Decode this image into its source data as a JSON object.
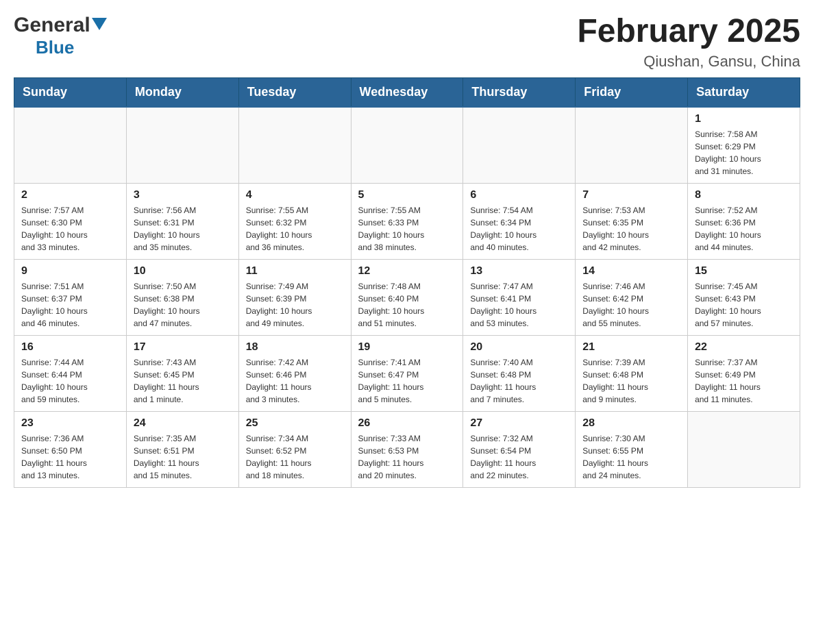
{
  "header": {
    "logo_general": "General",
    "logo_blue": "Blue",
    "title": "February 2025",
    "subtitle": "Qiushan, Gansu, China"
  },
  "days_of_week": [
    "Sunday",
    "Monday",
    "Tuesday",
    "Wednesday",
    "Thursday",
    "Friday",
    "Saturday"
  ],
  "weeks": [
    [
      {
        "day": "",
        "info": ""
      },
      {
        "day": "",
        "info": ""
      },
      {
        "day": "",
        "info": ""
      },
      {
        "day": "",
        "info": ""
      },
      {
        "day": "",
        "info": ""
      },
      {
        "day": "",
        "info": ""
      },
      {
        "day": "1",
        "info": "Sunrise: 7:58 AM\nSunset: 6:29 PM\nDaylight: 10 hours\nand 31 minutes."
      }
    ],
    [
      {
        "day": "2",
        "info": "Sunrise: 7:57 AM\nSunset: 6:30 PM\nDaylight: 10 hours\nand 33 minutes."
      },
      {
        "day": "3",
        "info": "Sunrise: 7:56 AM\nSunset: 6:31 PM\nDaylight: 10 hours\nand 35 minutes."
      },
      {
        "day": "4",
        "info": "Sunrise: 7:55 AM\nSunset: 6:32 PM\nDaylight: 10 hours\nand 36 minutes."
      },
      {
        "day": "5",
        "info": "Sunrise: 7:55 AM\nSunset: 6:33 PM\nDaylight: 10 hours\nand 38 minutes."
      },
      {
        "day": "6",
        "info": "Sunrise: 7:54 AM\nSunset: 6:34 PM\nDaylight: 10 hours\nand 40 minutes."
      },
      {
        "day": "7",
        "info": "Sunrise: 7:53 AM\nSunset: 6:35 PM\nDaylight: 10 hours\nand 42 minutes."
      },
      {
        "day": "8",
        "info": "Sunrise: 7:52 AM\nSunset: 6:36 PM\nDaylight: 10 hours\nand 44 minutes."
      }
    ],
    [
      {
        "day": "9",
        "info": "Sunrise: 7:51 AM\nSunset: 6:37 PM\nDaylight: 10 hours\nand 46 minutes."
      },
      {
        "day": "10",
        "info": "Sunrise: 7:50 AM\nSunset: 6:38 PM\nDaylight: 10 hours\nand 47 minutes."
      },
      {
        "day": "11",
        "info": "Sunrise: 7:49 AM\nSunset: 6:39 PM\nDaylight: 10 hours\nand 49 minutes."
      },
      {
        "day": "12",
        "info": "Sunrise: 7:48 AM\nSunset: 6:40 PM\nDaylight: 10 hours\nand 51 minutes."
      },
      {
        "day": "13",
        "info": "Sunrise: 7:47 AM\nSunset: 6:41 PM\nDaylight: 10 hours\nand 53 minutes."
      },
      {
        "day": "14",
        "info": "Sunrise: 7:46 AM\nSunset: 6:42 PM\nDaylight: 10 hours\nand 55 minutes."
      },
      {
        "day": "15",
        "info": "Sunrise: 7:45 AM\nSunset: 6:43 PM\nDaylight: 10 hours\nand 57 minutes."
      }
    ],
    [
      {
        "day": "16",
        "info": "Sunrise: 7:44 AM\nSunset: 6:44 PM\nDaylight: 10 hours\nand 59 minutes."
      },
      {
        "day": "17",
        "info": "Sunrise: 7:43 AM\nSunset: 6:45 PM\nDaylight: 11 hours\nand 1 minute."
      },
      {
        "day": "18",
        "info": "Sunrise: 7:42 AM\nSunset: 6:46 PM\nDaylight: 11 hours\nand 3 minutes."
      },
      {
        "day": "19",
        "info": "Sunrise: 7:41 AM\nSunset: 6:47 PM\nDaylight: 11 hours\nand 5 minutes."
      },
      {
        "day": "20",
        "info": "Sunrise: 7:40 AM\nSunset: 6:48 PM\nDaylight: 11 hours\nand 7 minutes."
      },
      {
        "day": "21",
        "info": "Sunrise: 7:39 AM\nSunset: 6:48 PM\nDaylight: 11 hours\nand 9 minutes."
      },
      {
        "day": "22",
        "info": "Sunrise: 7:37 AM\nSunset: 6:49 PM\nDaylight: 11 hours\nand 11 minutes."
      }
    ],
    [
      {
        "day": "23",
        "info": "Sunrise: 7:36 AM\nSunset: 6:50 PM\nDaylight: 11 hours\nand 13 minutes."
      },
      {
        "day": "24",
        "info": "Sunrise: 7:35 AM\nSunset: 6:51 PM\nDaylight: 11 hours\nand 15 minutes."
      },
      {
        "day": "25",
        "info": "Sunrise: 7:34 AM\nSunset: 6:52 PM\nDaylight: 11 hours\nand 18 minutes."
      },
      {
        "day": "26",
        "info": "Sunrise: 7:33 AM\nSunset: 6:53 PM\nDaylight: 11 hours\nand 20 minutes."
      },
      {
        "day": "27",
        "info": "Sunrise: 7:32 AM\nSunset: 6:54 PM\nDaylight: 11 hours\nand 22 minutes."
      },
      {
        "day": "28",
        "info": "Sunrise: 7:30 AM\nSunset: 6:55 PM\nDaylight: 11 hours\nand 24 minutes."
      },
      {
        "day": "",
        "info": ""
      }
    ]
  ]
}
